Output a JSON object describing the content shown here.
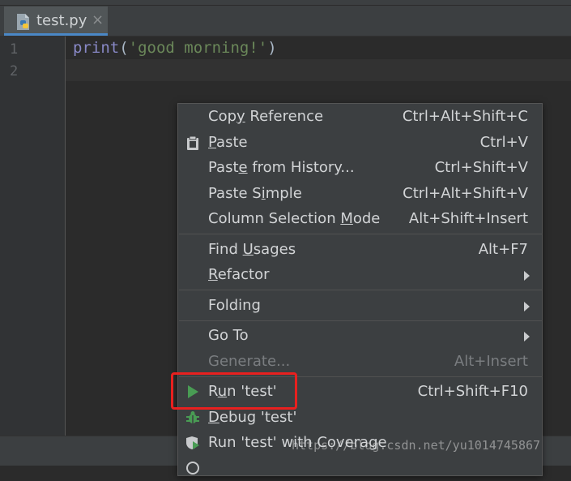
{
  "tab": {
    "title": "test.py",
    "close_glyph": "×",
    "icon": "python-file-icon"
  },
  "gutter": {
    "line_numbers": [
      "1",
      "2"
    ]
  },
  "code": {
    "fn": "print",
    "open": "(",
    "str": "'good morning!'",
    "close": ")"
  },
  "colors": {
    "accent": "#4a88c7",
    "run": "#499c54",
    "highlight_box": "#e8201f"
  },
  "menu": {
    "copy_reference": {
      "pre": "Cop",
      "u": "y",
      "post": " Reference",
      "shortcut": "Ctrl+Alt+Shift+C"
    },
    "paste": {
      "pre": "",
      "u": "P",
      "post": "aste",
      "shortcut": "Ctrl+V"
    },
    "paste_history": {
      "pre": "Past",
      "u": "e",
      "post": " from History...",
      "shortcut": "Ctrl+Shift+V"
    },
    "paste_simple": {
      "pre": "Paste S",
      "u": "i",
      "post": "mple",
      "shortcut": "Ctrl+Alt+Shift+V"
    },
    "column_selection": {
      "pre": "Column Selection ",
      "u": "M",
      "post": "ode",
      "shortcut": "Alt+Shift+Insert"
    },
    "find_usages": {
      "pre": "Find ",
      "u": "U",
      "post": "sages",
      "shortcut": "Alt+F7"
    },
    "refactor": {
      "pre": "",
      "u": "R",
      "post": "efactor"
    },
    "folding": {
      "label": "Folding"
    },
    "go_to": {
      "label": "Go To"
    },
    "generate": {
      "label": "Generate...",
      "shortcut": "Alt+Insert"
    },
    "run": {
      "pre": "R",
      "u": "u",
      "post": "n 'test'",
      "shortcut": "Ctrl+Shift+F10"
    },
    "debug": {
      "pre": "",
      "u": "D",
      "post": "ebug 'test'"
    },
    "run_coverage": {
      "label": "Run 'test' with Coverage"
    }
  },
  "watermark": "https://blog.csdn.net/yu1014745867"
}
